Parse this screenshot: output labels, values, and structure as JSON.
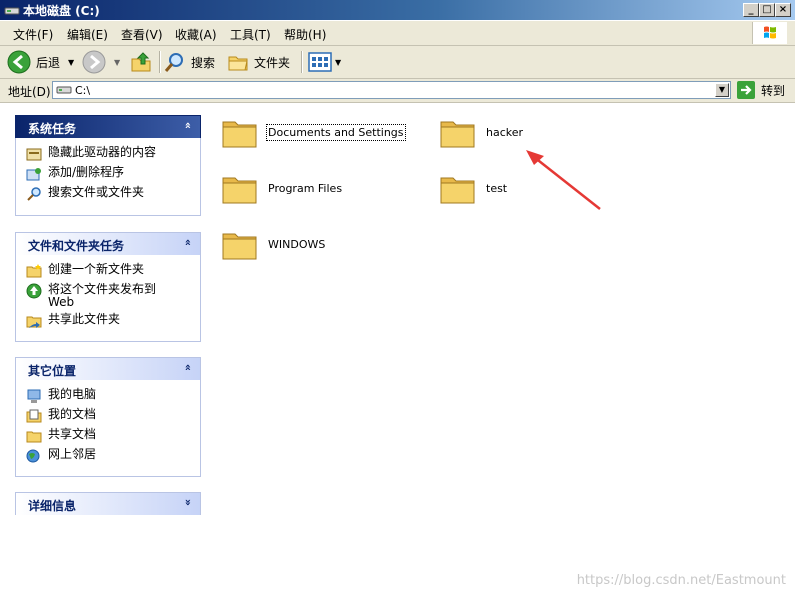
{
  "window": {
    "title": "本地磁盘 (C:)",
    "buttons": [
      "_",
      "□",
      "×"
    ]
  },
  "menu": [
    {
      "label": "文件(F)"
    },
    {
      "label": "编辑(E)"
    },
    {
      "label": "查看(V)"
    },
    {
      "label": "收藏(A)"
    },
    {
      "label": "工具(T)"
    },
    {
      "label": "帮助(H)"
    }
  ],
  "toolbar": {
    "back": "后退",
    "search": "搜索",
    "folders": "文件夹"
  },
  "address": {
    "label": "地址(D)",
    "value": "C:\\",
    "go": "转到"
  },
  "panels": {
    "system": {
      "title": "系统任务",
      "chevron": "»",
      "items": [
        {
          "label": "隐藏此驱动器的内容",
          "icon": "hide-contents-icon"
        },
        {
          "label": "添加/删除程序",
          "icon": "add-remove-programs-icon"
        },
        {
          "label": "搜索文件或文件夹",
          "icon": "search-icon"
        }
      ]
    },
    "file": {
      "title": "文件和文件夹任务",
      "chevron": "»",
      "items": [
        {
          "label": "创建一个新文件夹",
          "icon": "new-folder-icon"
        },
        {
          "label": "将这个文件夹发布到\nWeb",
          "icon": "publish-web-icon"
        },
        {
          "label": "共享此文件夹",
          "icon": "share-folder-icon"
        }
      ]
    },
    "places": {
      "title": "其它位置",
      "chevron": "»",
      "items": [
        {
          "label": "我的电脑",
          "icon": "my-computer-icon"
        },
        {
          "label": "我的文档",
          "icon": "my-documents-icon"
        },
        {
          "label": "共享文档",
          "icon": "shared-documents-icon"
        },
        {
          "label": "网上邻居",
          "icon": "network-places-icon"
        }
      ]
    },
    "details": {
      "title": "详细信息",
      "chevron": "«"
    }
  },
  "folders": [
    {
      "name": "Documents and Settings"
    },
    {
      "name": "hacker"
    },
    {
      "name": "Program Files"
    },
    {
      "name": "test"
    },
    {
      "name": "WINDOWS"
    }
  ],
  "watermark": "https://blog.csdn.net/Eastmount",
  "colors": {
    "titlebar": "#0a246a",
    "panel_dark": "#0a246a",
    "arrow": "#e53935",
    "folder": "#f5d36a"
  }
}
